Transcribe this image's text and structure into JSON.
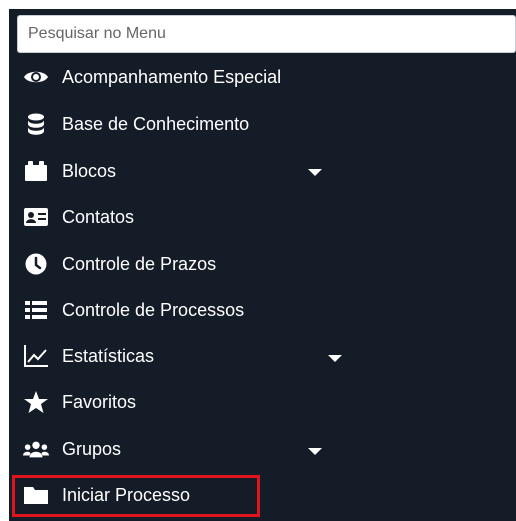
{
  "search": {
    "placeholder": "Pesquisar no Menu"
  },
  "menu": {
    "items": [
      {
        "label": "Acompanhamento Especial",
        "icon": "eye-icon"
      },
      {
        "label": "Base de Conhecimento",
        "icon": "database-icon"
      },
      {
        "label": "Blocos",
        "icon": "blocks-icon",
        "has_submenu": true
      },
      {
        "label": "Contatos",
        "icon": "contact-card-icon"
      },
      {
        "label": "Controle de Prazos",
        "icon": "clock-icon"
      },
      {
        "label": "Controle de Processos",
        "icon": "list-icon"
      },
      {
        "label": "Estatísticas",
        "icon": "line-chart-icon",
        "has_submenu": true
      },
      {
        "label": "Favoritos",
        "icon": "star-icon"
      },
      {
        "label": "Grupos",
        "icon": "users-icon",
        "has_submenu": true
      },
      {
        "label": "Iniciar Processo",
        "icon": "folder-icon",
        "highlighted": true
      }
    ]
  },
  "colors": {
    "menu_background": "#141c27",
    "text": "#ffffff",
    "highlight_border": "#e0141c"
  }
}
